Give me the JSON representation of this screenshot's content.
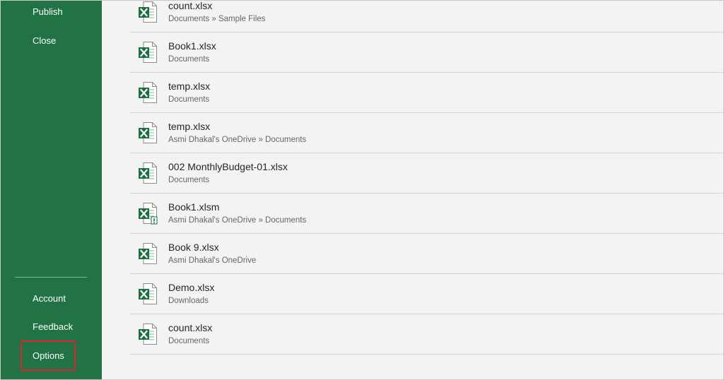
{
  "sidebar": {
    "items": [
      {
        "label": "Publish"
      },
      {
        "label": "Close"
      },
      {
        "label": "Account"
      },
      {
        "label": "Feedback"
      },
      {
        "label": "Options"
      }
    ],
    "background": "#217346",
    "highlight_color": "#d9262c"
  },
  "recent_files": [
    {
      "name": "count.xlsx",
      "path": "Documents » Sample Files",
      "icon": "excel-file-icon"
    },
    {
      "name": "Book1.xlsx",
      "path": "Documents",
      "icon": "excel-file-icon"
    },
    {
      "name": "temp.xlsx",
      "path": "Documents",
      "icon": "excel-file-icon"
    },
    {
      "name": "temp.xlsx",
      "path": "Asmi Dhakal's OneDrive » Documents",
      "icon": "excel-file-icon"
    },
    {
      "name": "002 MonthlyBudget-01.xlsx",
      "path": "Documents",
      "icon": "excel-file-icon"
    },
    {
      "name": "Book1.xlsm",
      "path": "Asmi Dhakal's OneDrive » Documents",
      "icon": "excel-macro-file-icon"
    },
    {
      "name": "Book 9.xlsx",
      "path": "Asmi Dhakal's OneDrive",
      "icon": "excel-file-icon"
    },
    {
      "name": "Demo.xlsx",
      "path": "Downloads",
      "icon": "excel-file-icon"
    },
    {
      "name": "count.xlsx",
      "path": "Documents",
      "icon": "excel-file-icon"
    }
  ]
}
